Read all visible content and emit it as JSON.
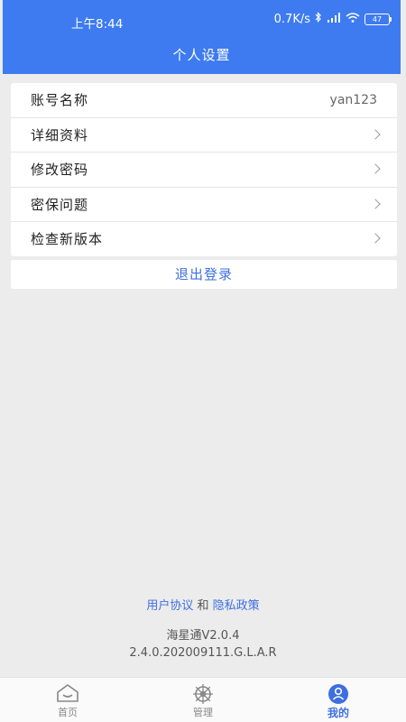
{
  "status_bar": {
    "time": "上午8:44",
    "network_speed": "0.7K/s",
    "battery": "47"
  },
  "header": {
    "title": "个人设置"
  },
  "settings": {
    "items": [
      {
        "label": "账号名称",
        "value": "yan123"
      },
      {
        "label": "详细资料"
      },
      {
        "label": "修改密码"
      },
      {
        "label": "密保问题"
      },
      {
        "label": "检查新版本"
      }
    ]
  },
  "logout_label": "退出登录",
  "footer": {
    "user_agreement": "用户协议",
    "and": "和",
    "privacy_policy": "隐私政策",
    "app_version": "海星通V2.0.4",
    "build": "2.4.0.202009111.G.L.A.R"
  },
  "tabs": [
    {
      "label": "首页",
      "icon": "home-icon"
    },
    {
      "label": "管理",
      "icon": "ship-wheel-icon"
    },
    {
      "label": "我的",
      "icon": "user-icon",
      "active": true
    }
  ],
  "colors": {
    "accent": "#3e7bf0",
    "link": "#3e6fe0"
  }
}
